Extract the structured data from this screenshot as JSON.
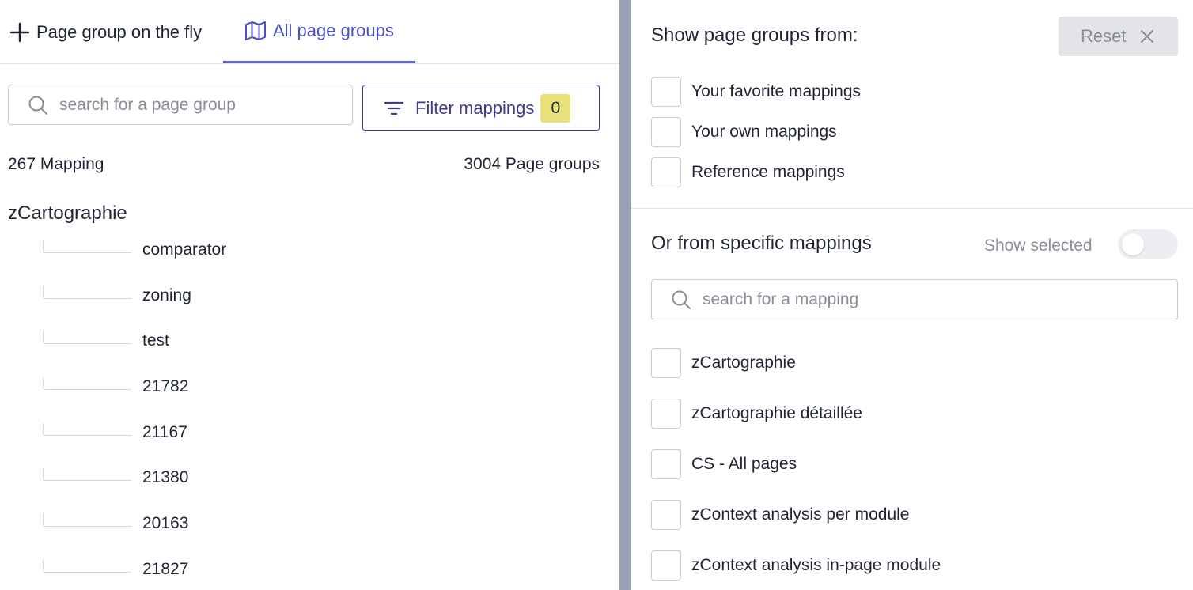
{
  "tabs": {
    "fly_label": "Page group on the fly",
    "all_label": "All page groups"
  },
  "left": {
    "search_placeholder": "search for a page group",
    "filter_label": "Filter mappings",
    "filter_count": "0",
    "mapping_count": "267 Mapping",
    "pagegroup_count": "3004 Page groups",
    "group_title": "zCartographie",
    "items": [
      "comparator",
      "zoning",
      "test",
      "21782",
      "21167",
      "21380",
      "20163",
      "21827"
    ]
  },
  "right": {
    "title": "Show page groups from:",
    "reset_label": "Reset",
    "sources": [
      "Your favorite mappings",
      "Your own mappings",
      "Reference mappings"
    ],
    "subtitle": "Or from specific mappings",
    "show_selected": "Show selected",
    "search_placeholder": "search for a mapping",
    "mappings": [
      "zCartographie",
      "zCartographie détaillée",
      "CS - All pages",
      "zContext analysis per module",
      "zContext analysis in-page module"
    ]
  },
  "colors": {
    "accent": "#4b4fc4",
    "filter_border": "#3e3a8c",
    "badge": "#e8e07a",
    "backdrop_strip": "#9aa0b4"
  }
}
